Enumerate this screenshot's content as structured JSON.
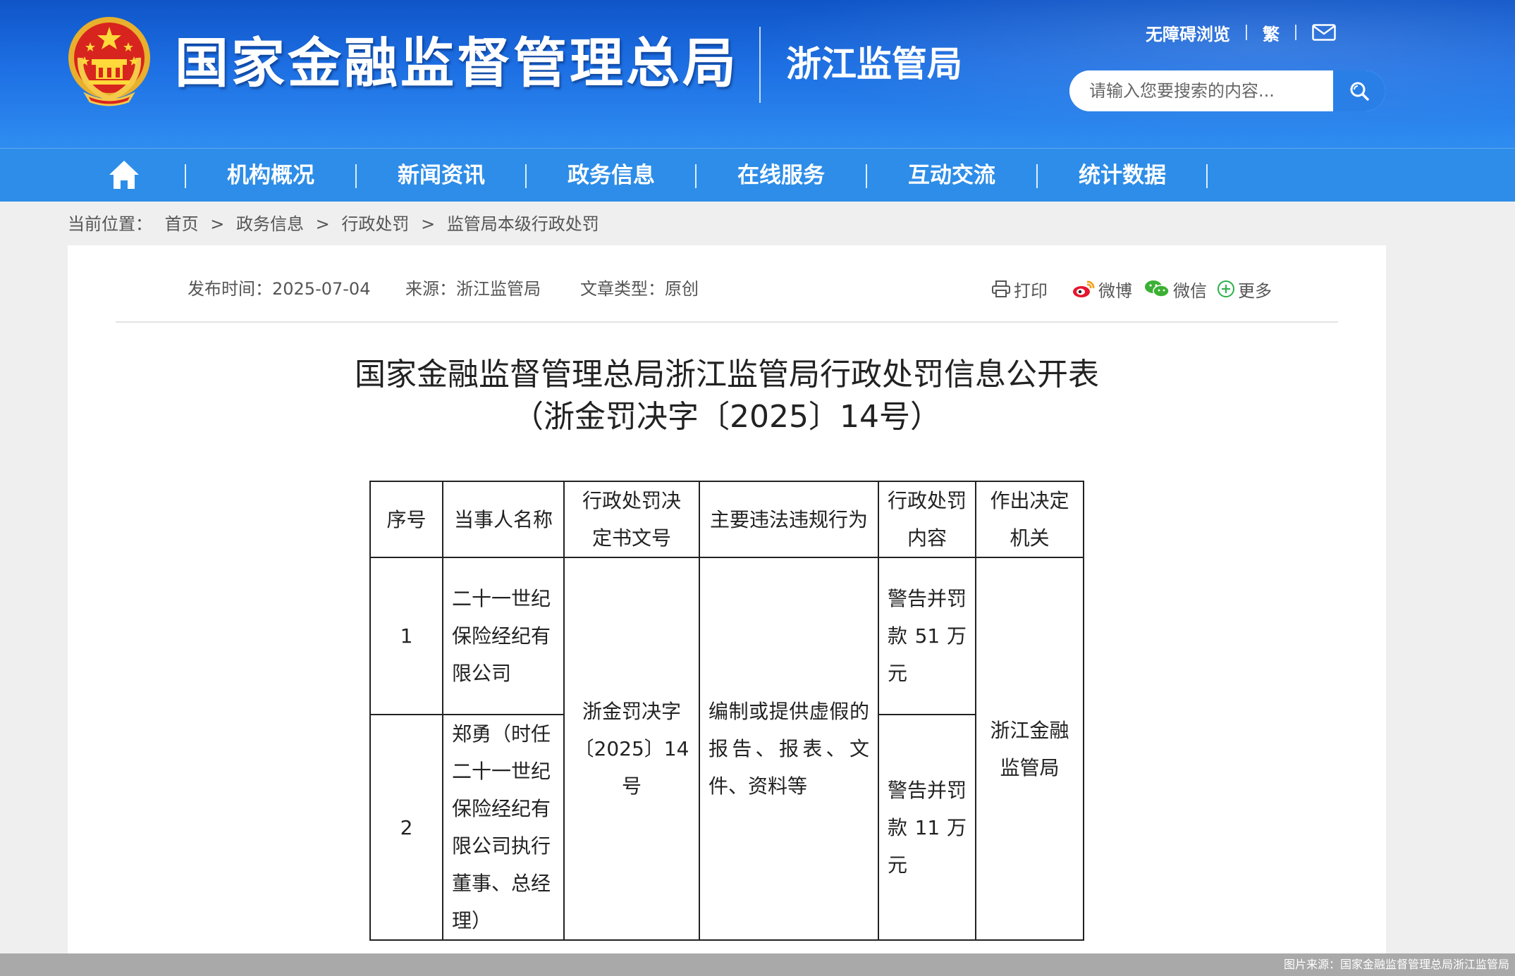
{
  "header": {
    "site_title": "国家金融监督管理总局",
    "sub_title": "浙江监管局",
    "accessibility_link": "无障碍浏览",
    "traditional_link": "繁",
    "mail_icon": "mail-icon",
    "search_placeholder": "请输入您要搜索的内容...",
    "search_icon": "search-icon",
    "emblem_icon": "national-emblem-icon"
  },
  "nav": {
    "home_icon": "home-icon",
    "items": [
      {
        "label": "机构概况"
      },
      {
        "label": "新闻资讯"
      },
      {
        "label": "政务信息"
      },
      {
        "label": "在线服务"
      },
      {
        "label": "互动交流"
      },
      {
        "label": "统计数据"
      }
    ]
  },
  "breadcrumb": {
    "prefix": "当前位置：",
    "separator": ">",
    "items": [
      "首页",
      "政务信息",
      "行政处罚",
      "监管局本级行政处罚"
    ]
  },
  "article": {
    "publish_time": "发布时间：2025-07-04",
    "source": "来源：浙江监管局",
    "type": "文章类型：原创",
    "share": {
      "print": "打印",
      "weibo": "微博",
      "wechat": "微信",
      "more": "更多"
    },
    "title_line1": "国家金融监督管理总局浙江监管局行政处罚信息公开表",
    "title_line2": "（浙金罚决字〔2025〕14号）"
  },
  "table": {
    "headers": [
      "序号",
      "当事人名称",
      "行政处罚决定书文号",
      "主要违法违规行为",
      "行政处罚内容",
      "作出决定机关"
    ],
    "rows": [
      {
        "no": "1",
        "party": "二十一世纪保险经纪有限公司",
        "penalty": "警告并罚款 51 万元"
      },
      {
        "no": "2",
        "party": "郑勇（时任二十一世纪保险经纪有限公司执行董事、总经理）",
        "penalty": "警告并罚款 11 万元"
      }
    ],
    "doc_number": "浙金罚决字〔2025〕14号",
    "violation": "编制或提供虚假的报告、报表、文件、资料等",
    "authority": "浙江金融监管局"
  },
  "footer": {
    "credit": "图片来源：国家金融监督管理总局浙江监管局"
  },
  "colors": {
    "header_top": "#0f55c8",
    "nav_bg": "#2d8de8",
    "search_button": "#2a7fe6",
    "page_bg": "#efefef"
  }
}
